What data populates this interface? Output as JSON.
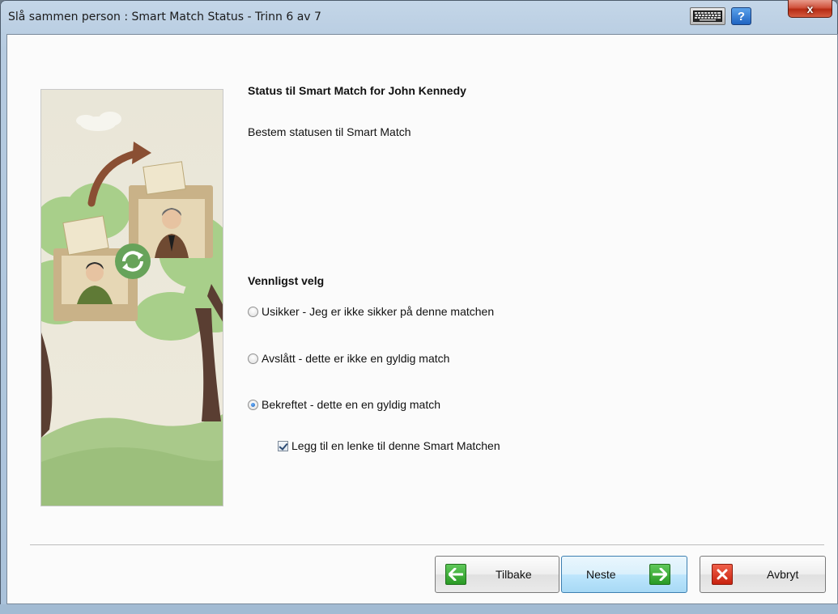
{
  "window": {
    "title": "Slå sammen person : Smart Match Status - Trinn 6 av 7",
    "help_label": "?",
    "close_label": "x"
  },
  "content": {
    "heading": "Status til Smart Match for John Kennedy",
    "description": "Bestem statusen til Smart Match",
    "choose_label": "Vennligst velg"
  },
  "options": [
    {
      "label": "Usikker - Jeg er ikke sikker på denne matchen",
      "selected": false
    },
    {
      "label": "Avslått - dette er ikke en gyldig match",
      "selected": false
    },
    {
      "label": "Bekreftet - dette en en gyldig match",
      "selected": true
    }
  ],
  "link_checkbox": {
    "label": "Legg til en lenke til denne Smart Matchen",
    "checked": true
  },
  "buttons": {
    "back": "Tilbake",
    "next": "Neste",
    "cancel": "Avbryt"
  },
  "colors": {
    "nav_icon": "#2a9a25",
    "cancel_icon": "#c8220f",
    "default_button": "#bee6fd"
  },
  "icons": {
    "back": "arrow-left-icon",
    "next": "arrow-right-icon",
    "cancel": "x-icon",
    "keyboard": "keyboard-icon",
    "help": "help-icon",
    "close": "close-icon"
  }
}
